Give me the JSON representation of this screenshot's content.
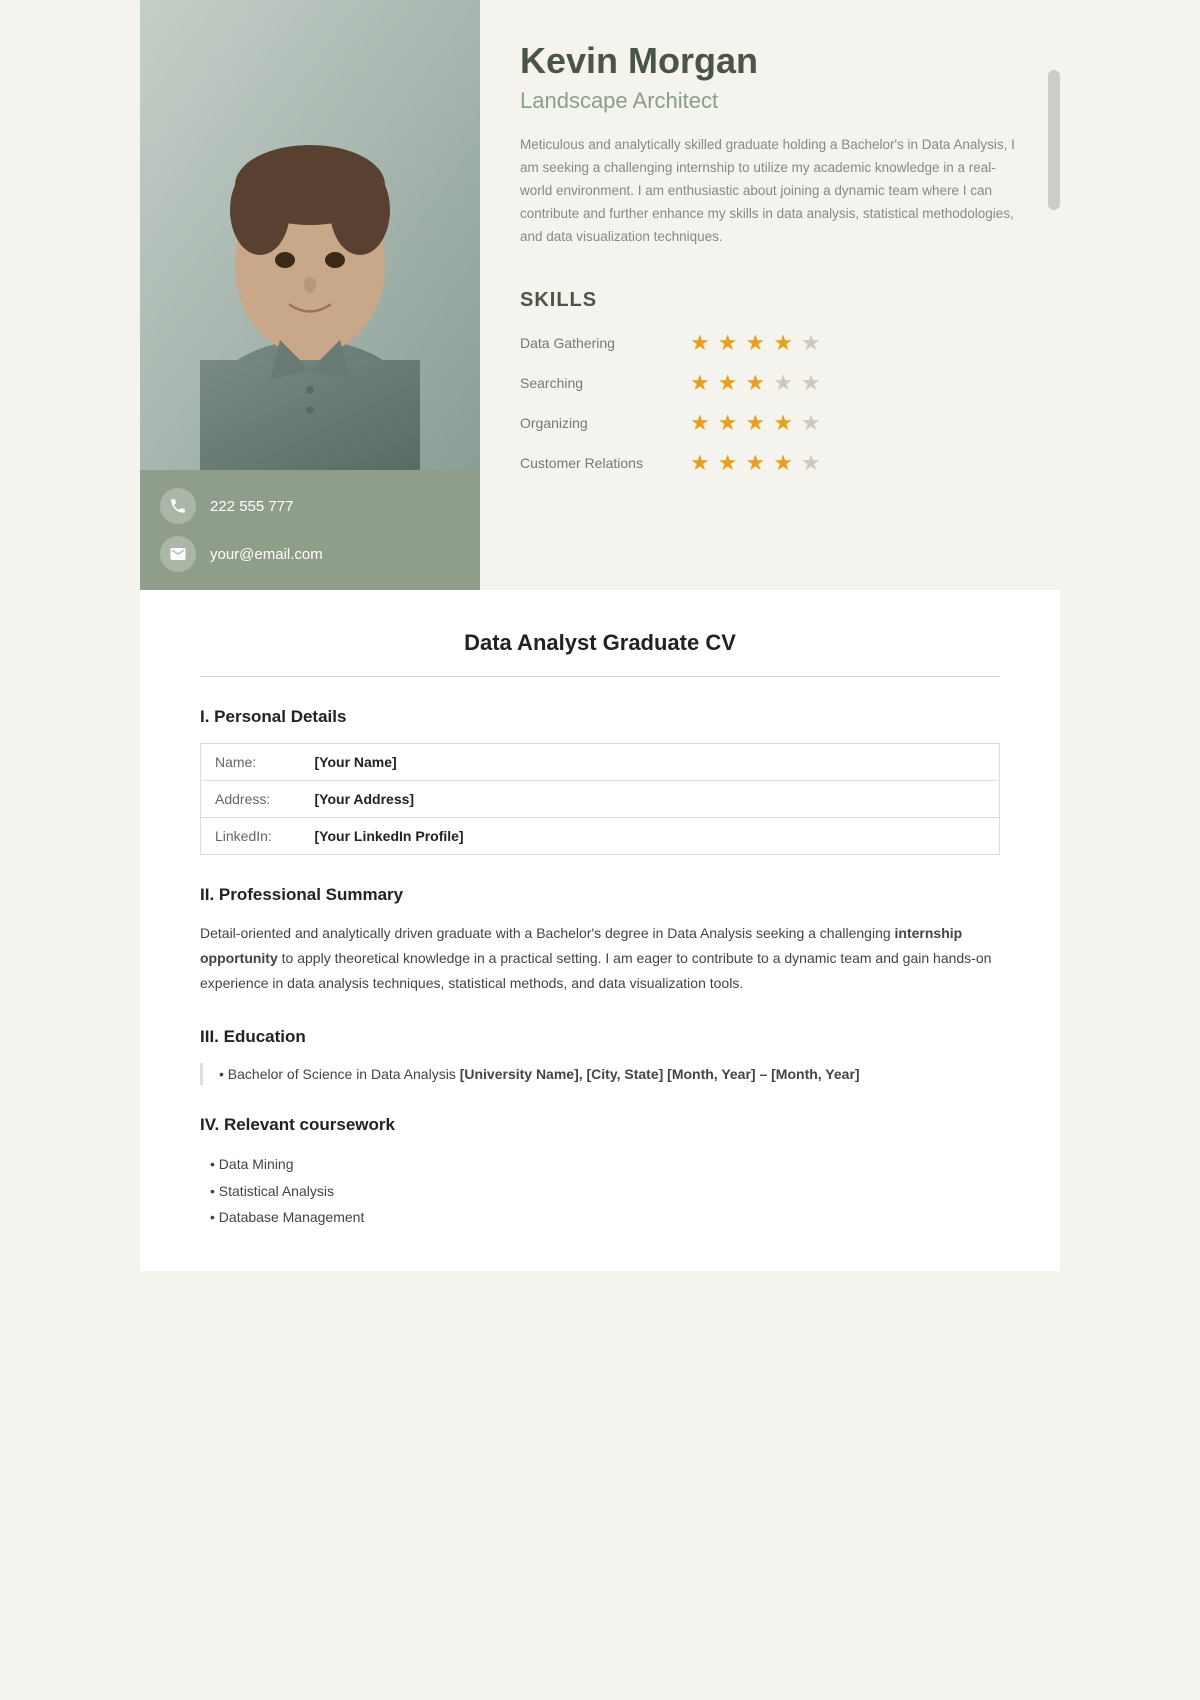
{
  "profile": {
    "name": "Kevin Morgan",
    "title": "Landscape Architect",
    "summary": "Meticulous and analytically skilled graduate holding a Bachelor's in Data Analysis, I am seeking a challenging internship to utilize my academic knowledge in a real-world environment. I am enthusiastic about joining a dynamic team where I can contribute and further enhance my skills in data analysis, statistical methodologies, and data visualization techniques.",
    "phone": "222 555 777",
    "email": "your@email.com"
  },
  "skills": {
    "heading": "SKILLS",
    "items": [
      {
        "name": "Data Gathering",
        "filled": 4,
        "empty": 1
      },
      {
        "name": "Searching",
        "filled": 3,
        "empty": 2
      },
      {
        "name": "Organizing",
        "filled": 4,
        "empty": 1
      },
      {
        "name": "Customer Relations",
        "filled": 4,
        "empty": 1
      }
    ]
  },
  "document": {
    "title": "Data Analyst Graduate CV",
    "sections": {
      "personal_details": {
        "heading": "I. Personal Details",
        "rows": [
          {
            "label": "Name:",
            "value": "[Your Name]"
          },
          {
            "label": "Address:",
            "value": "[Your Address]"
          },
          {
            "label": "LinkedIn:",
            "value": "[Your LinkedIn Profile]"
          }
        ]
      },
      "professional_summary": {
        "heading": "II. Professional Summary",
        "text_start": "Detail-oriented and analytically driven graduate with a Bachelor's degree in Data Analysis seeking a challenging ",
        "text_bold": "internship opportunity",
        "text_end": " to apply theoretical knowledge in a practical setting. I am eager to contribute to a dynamic team and gain hands-on experience in data analysis techniques, statistical methods, and data visualization tools."
      },
      "education": {
        "heading": "III. Education",
        "item": "• Bachelor of Science in Data Analysis ",
        "item_bold": "[University Name], [City, State] [Month, Year] – [Month, Year]"
      },
      "coursework": {
        "heading": "IV. Relevant coursework",
        "items": [
          "Data Mining",
          "Statistical Analysis",
          "Database Management"
        ]
      }
    }
  }
}
